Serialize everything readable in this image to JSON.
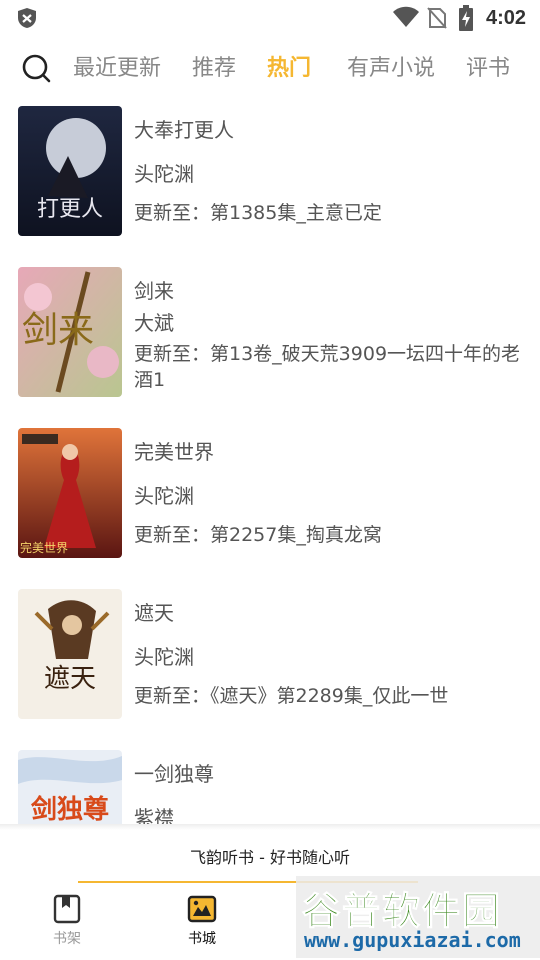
{
  "status_bar": {
    "time": "4:02"
  },
  "tabs": [
    {
      "label": "最近更新",
      "active": false
    },
    {
      "label": "推荐",
      "active": false
    },
    {
      "label": "热门",
      "active": true
    },
    {
      "label": "有声小说",
      "active": false
    },
    {
      "label": "评书",
      "active": false
    }
  ],
  "books": [
    {
      "title": "大奉打更人",
      "author": "头陀渊",
      "update": "更新至：第1385集_主意已定",
      "cover_text": "打更人",
      "cover_colors": [
        "#1f2740",
        "#6d7a9c"
      ]
    },
    {
      "title": "剑来",
      "author": "大斌",
      "update": "更新至：第13卷_破天荒3909一坛四十年的老酒1",
      "cover_text": "剑来",
      "cover_colors": [
        "#e7a8b8",
        "#c8d6a8"
      ]
    },
    {
      "title": "完美世界",
      "author": "头陀渊",
      "update": "更新至：第2257集_掏真龙窝",
      "cover_text": "完美世界",
      "cover_colors": [
        "#7a1d1a",
        "#e0743a"
      ]
    },
    {
      "title": "遮天",
      "author": "头陀渊",
      "update": "更新至：《遮天》第2289集_仅此一世",
      "cover_text": "遮天",
      "cover_colors": [
        "#f4efe6",
        "#c59a5a"
      ]
    },
    {
      "title": "一剑独尊",
      "author": "紫襟",
      "update": "",
      "cover_text": "剑独尊",
      "cover_colors": [
        "#e9eef5",
        "#c9d8ea"
      ]
    }
  ],
  "player": {
    "caption": "飞韵听书 - 好书随心听",
    "progress": 0.62
  },
  "bottom_nav": [
    {
      "label": "书架",
      "active": false
    },
    {
      "label": "书城",
      "active": true
    }
  ],
  "watermark": {
    "title": "谷普软件园",
    "url": "www.gupuxiazai.com"
  },
  "colors": {
    "accent": "#f5b731",
    "text": "#555555",
    "muted": "#888888"
  }
}
